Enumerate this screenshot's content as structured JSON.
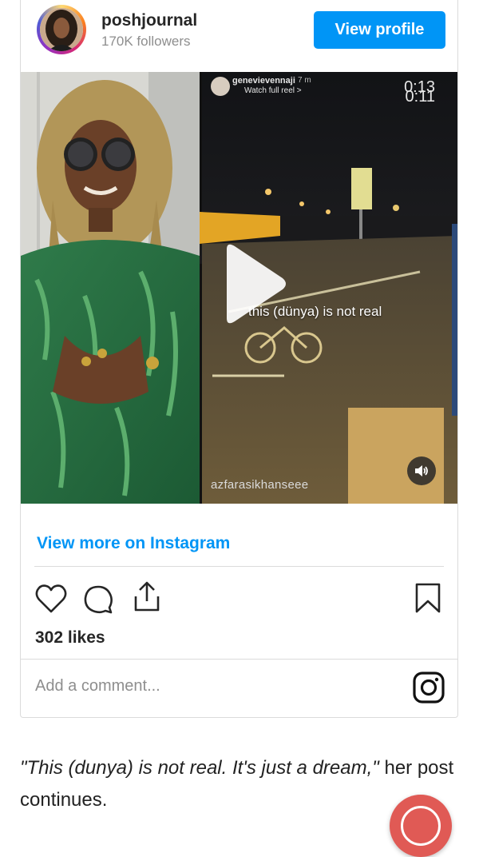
{
  "embed": {
    "username": "poshjournal",
    "followers": "170K followers",
    "view_profile_label": "View profile",
    "view_more_label": "View more on Instagram",
    "likes": "302 likes",
    "comment_placeholder": "Add a comment..."
  },
  "media": {
    "reel_username": "genevievennaji",
    "reel_age": "7 m",
    "watch_full_reel": "Watch full reel >",
    "time_top": "0:13",
    "time_bottom": "0:11",
    "caption_overlay": "this (dünya) is not real",
    "credit_overlay": "azfarasikhanseee"
  },
  "icons": {
    "like": "heart-icon",
    "comment": "comment-bubble-icon",
    "share": "share-upload-icon",
    "save": "bookmark-icon",
    "instagram": "instagram-logo-icon",
    "play": "play-icon",
    "sound": "speaker-icon"
  },
  "article": {
    "quote": "\"This (dunya) is not real. It's just a dream,\"",
    "rest": " her post continues."
  },
  "colors": {
    "accent": "#0095f6",
    "fab": "#e05a55"
  }
}
